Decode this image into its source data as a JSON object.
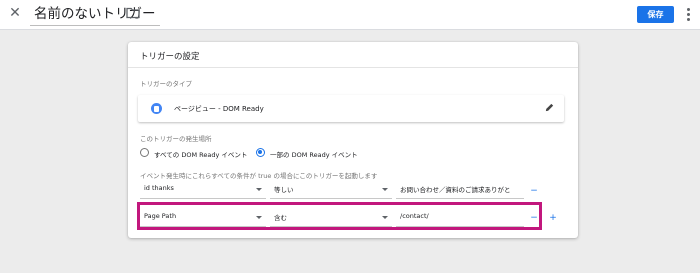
{
  "header": {
    "close_glyph": "✕",
    "title": "名前のないトリガー",
    "folder_icon": "folder-icon",
    "save_label": "保存",
    "more_icon": "more-vert-icon"
  },
  "card": {
    "title": "トリガーの設定",
    "type_label": "トリガーのタイプ",
    "type_value": "ページビュー - DOM Ready",
    "fire_label": "このトリガーの発生場所",
    "radio_all": "すべての DOM Ready イベント",
    "radio_some": "一部の DOM Ready イベント",
    "condition_label": "イベント発生時にこれらすべての条件が true の場合にこのトリガーを起動します",
    "conditions": [
      {
        "variable": "id thanks",
        "operator": "等しい",
        "value": "お問い合わせ／資料のご請求ありがと",
        "remove": "−",
        "add": ""
      },
      {
        "variable": "Page Path",
        "operator": "含む",
        "value": "/contact/",
        "remove": "−",
        "add": "+"
      }
    ]
  },
  "colors": {
    "accent": "#1a73e8",
    "highlight": "#c2177d"
  }
}
